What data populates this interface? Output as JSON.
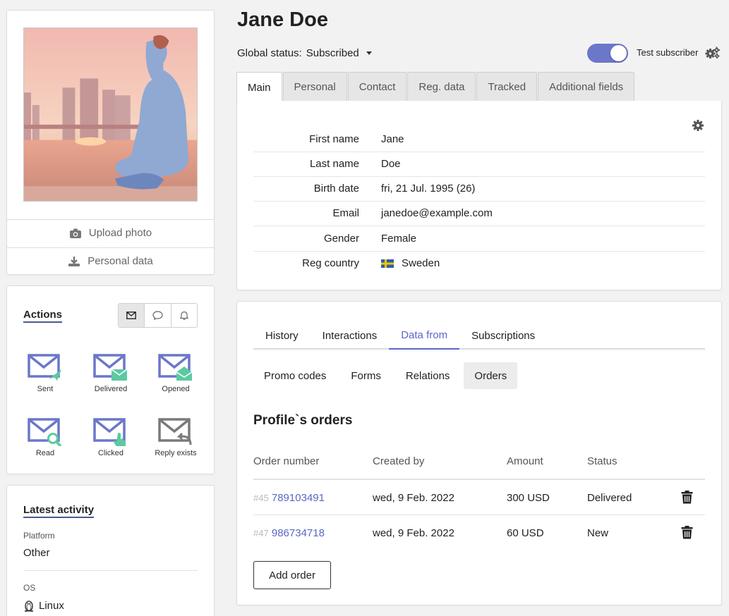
{
  "profile": {
    "upload_photo_label": "Upload photo",
    "personal_data_label": "Personal data"
  },
  "actions": {
    "title": "Actions",
    "items": [
      {
        "label": "Sent",
        "icon": "envelope-sent-icon"
      },
      {
        "label": "Delivered",
        "icon": "envelope-delivered-icon"
      },
      {
        "label": "Opened",
        "icon": "envelope-opened-icon"
      },
      {
        "label": "Read",
        "icon": "envelope-read-icon"
      },
      {
        "label": "Clicked",
        "icon": "envelope-clicked-icon"
      },
      {
        "label": "Reply exists",
        "icon": "envelope-reply-icon"
      }
    ]
  },
  "activity": {
    "title": "Latest activity",
    "platform_label": "Platform",
    "platform_value": "Other",
    "os_label": "OS",
    "os_value": "Linux"
  },
  "header": {
    "name": "Jane Doe",
    "global_status_label": "Global status:",
    "global_status_value": "Subscribed",
    "test_subscriber_label": "Test subscriber",
    "test_subscriber_on": true
  },
  "tabs": [
    "Main",
    "Personal",
    "Contact",
    "Reg. data",
    "Tracked",
    "Additional fields"
  ],
  "fields": [
    {
      "label": "First name",
      "value": "Jane"
    },
    {
      "label": "Last name",
      "value": "Doe"
    },
    {
      "label": "Birth date",
      "value": "fri, 21 Jul. 1995 (26)"
    },
    {
      "label": "Email",
      "value": "janedoe@example.com"
    },
    {
      "label": "Gender",
      "value": "Female"
    },
    {
      "label": "Reg country",
      "value": "Sweden"
    }
  ],
  "subtabs": [
    "History",
    "Interactions",
    "Data from",
    "Subscriptions"
  ],
  "pills": [
    "Promo codes",
    "Forms",
    "Relations",
    "Orders"
  ],
  "orders": {
    "title": "Profile`s orders",
    "columns": [
      "Order number",
      "Created by",
      "Amount",
      "Status"
    ],
    "rows": [
      {
        "id": "#45",
        "number": "789103491",
        "created": "wed, 9 Feb. 2022",
        "amount": "300 USD",
        "status": "Delivered"
      },
      {
        "id": "#47",
        "number": "986734718",
        "created": "wed, 9 Feb. 2022",
        "amount": "60 USD",
        "status": "New"
      }
    ],
    "add_label": "Add order"
  },
  "colors": {
    "accent": "#5a67c4",
    "toggle": "#6b77c9",
    "envelope": "#6b77c9",
    "badge_green": "#5cc9a1"
  }
}
